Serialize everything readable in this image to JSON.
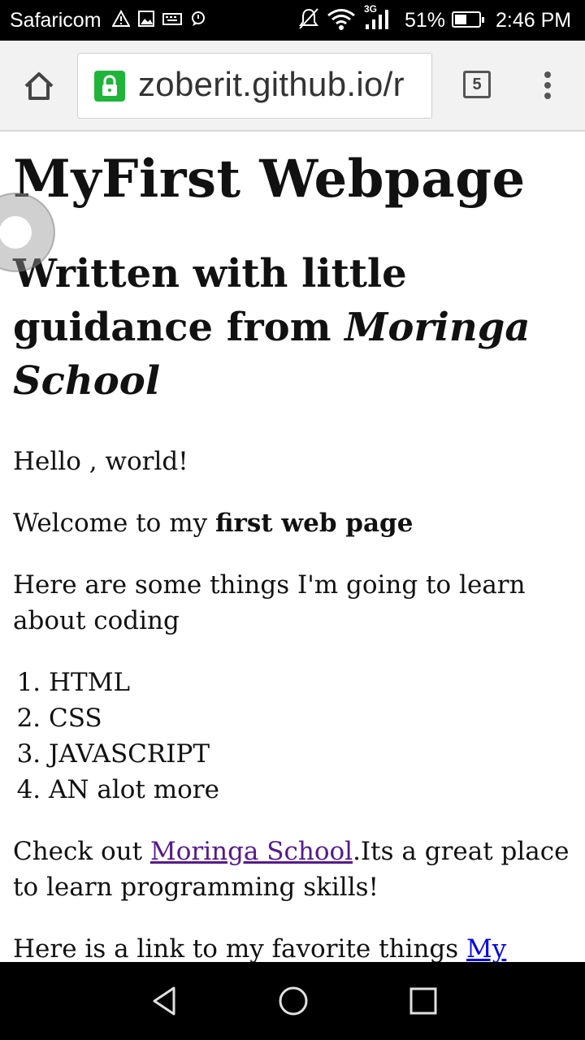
{
  "status_bar": {
    "carrier": "Safaricom",
    "network": "3G",
    "battery_percent": "51%",
    "battery_level": 0.51,
    "time": "2:46 PM"
  },
  "browser": {
    "url": "zoberit.github.io/r",
    "tab_count": "5"
  },
  "page": {
    "title": "MyFirst Webpage",
    "subtitle_lead": "Written with little guidance from ",
    "subtitle_emphasis": "Moringa School",
    "greeting": "Hello , world!",
    "welcome_lead": "Welcome to my ",
    "welcome_bold": "first web page",
    "things_intro": "Here are some things I'm going to learn about coding",
    "learn_items": [
      "HTML",
      "CSS",
      "JAVASCRIPT",
      "AN alot more"
    ],
    "check_lead": "Check out ",
    "check_link": "Moringa School",
    "check_tail": ".Its a great place to learn programming skills!",
    "fav_lead": "Here is a link to my favorite things ",
    "fav_link": "My favorite things"
  },
  "colors": {
    "visited_link": "#551a8b",
    "link": "#0000ee",
    "lock_green": "#1eb53a"
  },
  "icons": {
    "status_left": [
      "warning-icon",
      "image-icon",
      "keyboard-icon",
      "chat-bubble-icon"
    ],
    "status_right": [
      "mute-icon",
      "wifi-icon",
      "signal-icon",
      "battery-icon"
    ],
    "toolbar": [
      "home-icon",
      "lock-icon",
      "tabs-icon",
      "overflow-menu-icon"
    ],
    "nav": [
      "back-icon",
      "home-circle-icon",
      "recents-icon"
    ]
  }
}
